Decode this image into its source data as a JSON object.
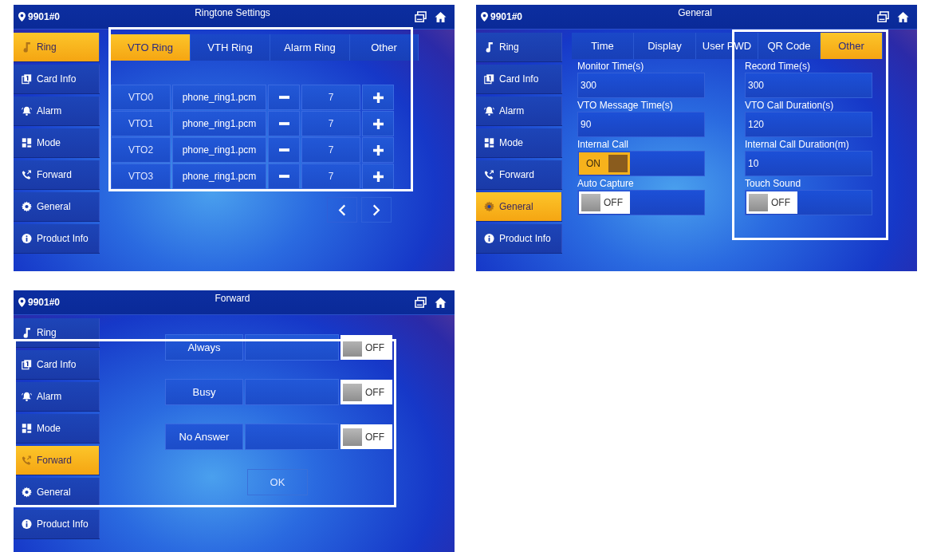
{
  "panels": [
    {
      "kind": "ringtone",
      "header": {
        "location": "9901#0",
        "title": "Ringtone Settings"
      },
      "highlighted": true,
      "sidebar": [
        {
          "label": "Ring",
          "selected": true
        },
        {
          "label": "Card Info",
          "selected": false
        },
        {
          "label": "Alarm",
          "selected": false
        },
        {
          "label": "Mode",
          "selected": false
        },
        {
          "label": "Forward",
          "selected": false
        },
        {
          "label": "General",
          "selected": false
        },
        {
          "label": "Product Info",
          "selected": false
        }
      ],
      "tabs": [
        {
          "label": "VTO Ring",
          "selected": true
        },
        {
          "label": "VTH Ring",
          "selected": false
        },
        {
          "label": "Alarm Ring",
          "selected": false
        },
        {
          "label": "Other",
          "selected": false
        }
      ],
      "rows": [
        {
          "device": "VTO0",
          "file": "phone_ring1.pcm",
          "volume": "7"
        },
        {
          "device": "VTO1",
          "file": "phone_ring1.pcm",
          "volume": "7"
        },
        {
          "device": "VTO2",
          "file": "phone_ring1.pcm",
          "volume": "7"
        },
        {
          "device": "VTO3",
          "file": "phone_ring1.pcm",
          "volume": "7"
        }
      ]
    },
    {
      "kind": "general",
      "header": {
        "location": "9901#0",
        "title": "General"
      },
      "highlighted": true,
      "sidebar": [
        {
          "label": "Ring",
          "selected": false
        },
        {
          "label": "Card Info",
          "selected": false
        },
        {
          "label": "Alarm",
          "selected": false
        },
        {
          "label": "Mode",
          "selected": false
        },
        {
          "label": "Forward",
          "selected": false
        },
        {
          "label": "General",
          "selected": true
        },
        {
          "label": "Product Info",
          "selected": false
        }
      ],
      "tabs": [
        {
          "label": "Time",
          "selected": false
        },
        {
          "label": "Display",
          "selected": false
        },
        {
          "label": "User PWD",
          "selected": false
        },
        {
          "label": "QR Code",
          "selected": false
        },
        {
          "label": "Other",
          "selected": true
        }
      ],
      "columns": [
        {
          "fields": [
            {
              "kind": "text",
              "label": "Monitor Time(s)",
              "value": "300"
            },
            {
              "kind": "text",
              "label": "VTO Message Time(s)",
              "value": "90"
            },
            {
              "kind": "toggle",
              "label": "Internal Call",
              "on": true,
              "state": "ON"
            },
            {
              "kind": "toggle",
              "label": "Auto Capture",
              "on": false,
              "state": "OFF"
            }
          ]
        },
        {
          "fields": [
            {
              "kind": "text",
              "label": "Record Time(s)",
              "value": "300"
            },
            {
              "kind": "text",
              "label": "VTO Call Duration(s)",
              "value": "120"
            },
            {
              "kind": "text",
              "label": "Internal Call Duration(m)",
              "value": "10"
            },
            {
              "kind": "toggle",
              "label": "Touch Sound",
              "on": false,
              "state": "OFF"
            }
          ]
        }
      ]
    },
    {
      "kind": "forward",
      "header": {
        "location": "9901#0",
        "title": "Forward"
      },
      "highlighted": true,
      "sidebar": [
        {
          "label": "Ring",
          "selected": false
        },
        {
          "label": "Card Info",
          "selected": false
        },
        {
          "label": "Alarm",
          "selected": false
        },
        {
          "label": "Mode",
          "selected": false
        },
        {
          "label": "Forward",
          "selected": true
        },
        {
          "label": "General",
          "selected": false
        },
        {
          "label": "Product Info",
          "selected": false
        }
      ],
      "rows": [
        {
          "label": "Always",
          "on": false,
          "state": "OFF"
        },
        {
          "label": "Busy",
          "on": false,
          "state": "OFF"
        },
        {
          "label": "No Answer",
          "on": false,
          "state": "OFF"
        }
      ],
      "button": "OK"
    }
  ]
}
